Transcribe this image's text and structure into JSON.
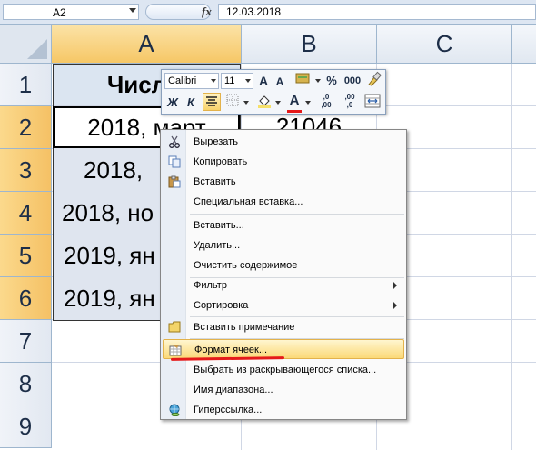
{
  "formula_bar": {
    "name_box": "A2",
    "fx": "fx",
    "value": "12.03.2018"
  },
  "columns": [
    "A",
    "B",
    "C"
  ],
  "rows": [
    "1",
    "2",
    "3",
    "4",
    "5",
    "6",
    "7",
    "8",
    "9"
  ],
  "cells": {
    "A1": "Числ",
    "A2": "2018, март",
    "A3": "2018,",
    "A4": "2018, но",
    "A5": "2019, ян",
    "A6": "2019, ян",
    "B2": "21046"
  },
  "mini_toolbar": {
    "font_name": "Calibri",
    "font_size": "11",
    "grow_font": "A",
    "shrink_font": "A",
    "percent": "%",
    "thousands": "000",
    "bold": "Ж",
    "italic": "К",
    "font_color": "A",
    "inc_decimal": ",0\n,00",
    "dec_decimal": ",00\n,0"
  },
  "context_menu": {
    "items": [
      {
        "label": "Вырезать",
        "icon": "scissors-icon"
      },
      {
        "label": "Копировать",
        "icon": "copy-icon"
      },
      {
        "label": "Вставить",
        "icon": "paste-icon"
      },
      {
        "label": "Специальная вставка...",
        "icon": ""
      },
      {
        "label": "Вставить...",
        "icon": ""
      },
      {
        "label": "Удалить...",
        "icon": ""
      },
      {
        "label": "Очистить содержимое",
        "icon": ""
      },
      {
        "label": "Фильтр",
        "icon": "",
        "submenu": true
      },
      {
        "label": "Сортировка",
        "icon": "",
        "submenu": true
      },
      {
        "label": "Вставить примечание",
        "icon": "comment-icon"
      },
      {
        "label": "Формат ячеек...",
        "icon": "format-cells-icon",
        "highlighted": true
      },
      {
        "label": "Выбрать из раскрывающегося списка...",
        "icon": ""
      },
      {
        "label": "Имя диапазона...",
        "icon": ""
      },
      {
        "label": "Гиперссылка...",
        "icon": "hyperlink-icon"
      }
    ]
  },
  "colors": {
    "selected_header": "#f6c766",
    "menu_highlight": "#fbd978",
    "annotation_underline": "#e51a1a",
    "header_cell_fill": "#dbe5f1"
  }
}
